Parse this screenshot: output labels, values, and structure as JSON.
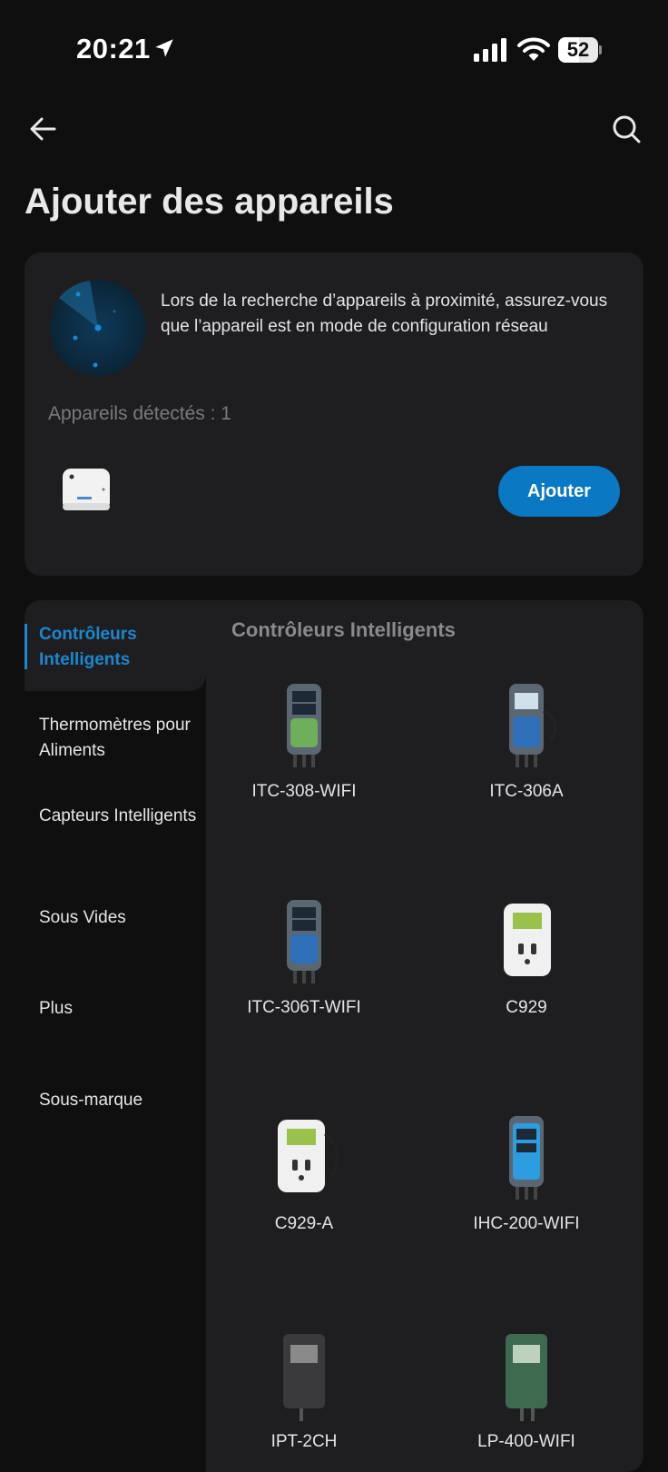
{
  "status_bar": {
    "time": "20:21",
    "battery": "52",
    "battery_level": 0.52,
    "icons": [
      "location-arrow-icon",
      "signal-icon",
      "wifi-icon",
      "battery-icon"
    ]
  },
  "nav": {
    "back_icon": "back-arrow-icon",
    "search_icon": "search-icon"
  },
  "page_title": "Ajouter des appareils",
  "scan_card": {
    "message": "Lors de la recherche d’appareils à proximité, assurez-vous que l’appareil est en mode de configuration réseau",
    "detected_label": "Appareils détectés : 1",
    "add_button": "Ajouter"
  },
  "catalog": {
    "sidebar": [
      {
        "label": "Contrôleurs Intelligents",
        "active": true
      },
      {
        "label": "Thermomètres pour Aliments",
        "active": false
      },
      {
        "label": "Capteurs Intelligents",
        "active": false
      },
      {
        "label": "Sous Vides",
        "active": false
      },
      {
        "label": "Plus",
        "active": false
      },
      {
        "label": "Sous-marque",
        "active": false
      }
    ],
    "section_title": "Contrôleurs Intelligents",
    "products": [
      {
        "name": "ITC-308-WIFI"
      },
      {
        "name": "ITC-306A"
      },
      {
        "name": "ITC-306T-WIFI"
      },
      {
        "name": "C929"
      },
      {
        "name": "C929-A"
      },
      {
        "name": "IHC-200-WIFI"
      },
      {
        "name": "IPT-2CH"
      },
      {
        "name": "LP-400-WIFI"
      }
    ]
  },
  "colors": {
    "accent": "#0a78c2",
    "active_text": "#1a88d0",
    "card_bg": "#1e1e20",
    "page_bg": "#0f0f10"
  }
}
